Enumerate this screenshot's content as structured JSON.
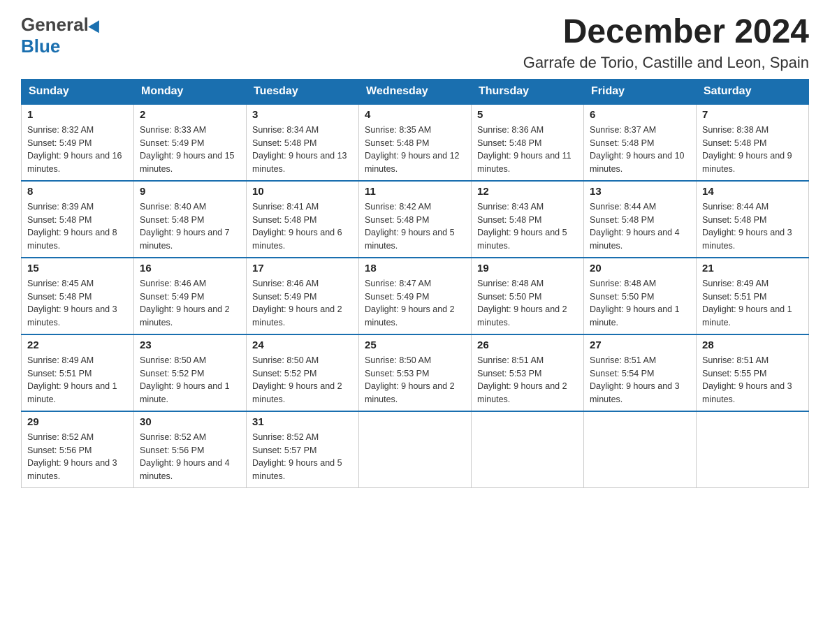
{
  "header": {
    "logo_general": "General",
    "logo_blue": "Blue",
    "month_title": "December 2024",
    "location": "Garrafe de Torio, Castille and Leon, Spain"
  },
  "weekdays": [
    "Sunday",
    "Monday",
    "Tuesday",
    "Wednesday",
    "Thursday",
    "Friday",
    "Saturday"
  ],
  "weeks": [
    [
      {
        "day": 1,
        "sunrise": "8:32 AM",
        "sunset": "5:49 PM",
        "daylight": "9 hours and 16 minutes."
      },
      {
        "day": 2,
        "sunrise": "8:33 AM",
        "sunset": "5:49 PM",
        "daylight": "9 hours and 15 minutes."
      },
      {
        "day": 3,
        "sunrise": "8:34 AM",
        "sunset": "5:48 PM",
        "daylight": "9 hours and 13 minutes."
      },
      {
        "day": 4,
        "sunrise": "8:35 AM",
        "sunset": "5:48 PM",
        "daylight": "9 hours and 12 minutes."
      },
      {
        "day": 5,
        "sunrise": "8:36 AM",
        "sunset": "5:48 PM",
        "daylight": "9 hours and 11 minutes."
      },
      {
        "day": 6,
        "sunrise": "8:37 AM",
        "sunset": "5:48 PM",
        "daylight": "9 hours and 10 minutes."
      },
      {
        "day": 7,
        "sunrise": "8:38 AM",
        "sunset": "5:48 PM",
        "daylight": "9 hours and 9 minutes."
      }
    ],
    [
      {
        "day": 8,
        "sunrise": "8:39 AM",
        "sunset": "5:48 PM",
        "daylight": "9 hours and 8 minutes."
      },
      {
        "day": 9,
        "sunrise": "8:40 AM",
        "sunset": "5:48 PM",
        "daylight": "9 hours and 7 minutes."
      },
      {
        "day": 10,
        "sunrise": "8:41 AM",
        "sunset": "5:48 PM",
        "daylight": "9 hours and 6 minutes."
      },
      {
        "day": 11,
        "sunrise": "8:42 AM",
        "sunset": "5:48 PM",
        "daylight": "9 hours and 5 minutes."
      },
      {
        "day": 12,
        "sunrise": "8:43 AM",
        "sunset": "5:48 PM",
        "daylight": "9 hours and 5 minutes."
      },
      {
        "day": 13,
        "sunrise": "8:44 AM",
        "sunset": "5:48 PM",
        "daylight": "9 hours and 4 minutes."
      },
      {
        "day": 14,
        "sunrise": "8:44 AM",
        "sunset": "5:48 PM",
        "daylight": "9 hours and 3 minutes."
      }
    ],
    [
      {
        "day": 15,
        "sunrise": "8:45 AM",
        "sunset": "5:48 PM",
        "daylight": "9 hours and 3 minutes."
      },
      {
        "day": 16,
        "sunrise": "8:46 AM",
        "sunset": "5:49 PM",
        "daylight": "9 hours and 2 minutes."
      },
      {
        "day": 17,
        "sunrise": "8:46 AM",
        "sunset": "5:49 PM",
        "daylight": "9 hours and 2 minutes."
      },
      {
        "day": 18,
        "sunrise": "8:47 AM",
        "sunset": "5:49 PM",
        "daylight": "9 hours and 2 minutes."
      },
      {
        "day": 19,
        "sunrise": "8:48 AM",
        "sunset": "5:50 PM",
        "daylight": "9 hours and 2 minutes."
      },
      {
        "day": 20,
        "sunrise": "8:48 AM",
        "sunset": "5:50 PM",
        "daylight": "9 hours and 1 minute."
      },
      {
        "day": 21,
        "sunrise": "8:49 AM",
        "sunset": "5:51 PM",
        "daylight": "9 hours and 1 minute."
      }
    ],
    [
      {
        "day": 22,
        "sunrise": "8:49 AM",
        "sunset": "5:51 PM",
        "daylight": "9 hours and 1 minute."
      },
      {
        "day": 23,
        "sunrise": "8:50 AM",
        "sunset": "5:52 PM",
        "daylight": "9 hours and 1 minute."
      },
      {
        "day": 24,
        "sunrise": "8:50 AM",
        "sunset": "5:52 PM",
        "daylight": "9 hours and 2 minutes."
      },
      {
        "day": 25,
        "sunrise": "8:50 AM",
        "sunset": "5:53 PM",
        "daylight": "9 hours and 2 minutes."
      },
      {
        "day": 26,
        "sunrise": "8:51 AM",
        "sunset": "5:53 PM",
        "daylight": "9 hours and 2 minutes."
      },
      {
        "day": 27,
        "sunrise": "8:51 AM",
        "sunset": "5:54 PM",
        "daylight": "9 hours and 3 minutes."
      },
      {
        "day": 28,
        "sunrise": "8:51 AM",
        "sunset": "5:55 PM",
        "daylight": "9 hours and 3 minutes."
      }
    ],
    [
      {
        "day": 29,
        "sunrise": "8:52 AM",
        "sunset": "5:56 PM",
        "daylight": "9 hours and 3 minutes."
      },
      {
        "day": 30,
        "sunrise": "8:52 AM",
        "sunset": "5:56 PM",
        "daylight": "9 hours and 4 minutes."
      },
      {
        "day": 31,
        "sunrise": "8:52 AM",
        "sunset": "5:57 PM",
        "daylight": "9 hours and 5 minutes."
      },
      null,
      null,
      null,
      null
    ]
  ]
}
